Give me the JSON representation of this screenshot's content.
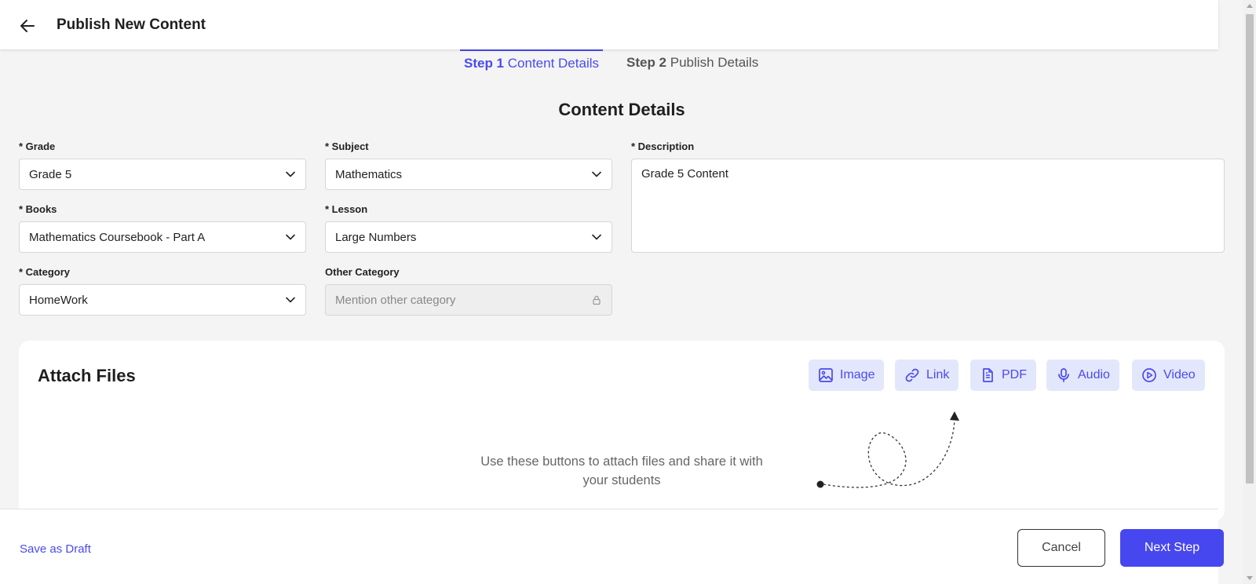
{
  "header": {
    "title": "Publish New Content"
  },
  "steps": [
    {
      "number": "Step 1",
      "label": "Content Details",
      "active": true
    },
    {
      "number": "Step 2",
      "label": "Publish Details",
      "active": false
    }
  ],
  "section_title": "Content Details",
  "fields": {
    "grade": {
      "label": "* Grade",
      "value": "Grade 5"
    },
    "subject": {
      "label": "* Subject",
      "value": "Mathematics"
    },
    "description": {
      "label": "* Description",
      "value": "Grade 5 Content"
    },
    "books": {
      "label": "* Books",
      "value": "Mathematics Coursebook - Part A"
    },
    "lesson": {
      "label": "* Lesson",
      "value": "Large Numbers"
    },
    "category": {
      "label": "* Category",
      "value": "HomeWork"
    },
    "other_category": {
      "label": "Other Category",
      "placeholder": "Mention other category"
    }
  },
  "attach": {
    "title": "Attach Files",
    "buttons": [
      {
        "label": "Image",
        "icon": "image-icon"
      },
      {
        "label": "Link",
        "icon": "link-icon"
      },
      {
        "label": "PDF",
        "icon": "file-text-icon"
      },
      {
        "label": "Audio",
        "icon": "microphone-icon"
      },
      {
        "label": "Video",
        "icon": "play-circle-icon"
      }
    ],
    "hint": "Use these buttons to attach files and share it with your students"
  },
  "footer": {
    "draft_label": "Save as Draft",
    "cancel_label": "Cancel",
    "next_label": "Next Step"
  },
  "colors": {
    "accent": "#4a4af0",
    "attach_button_bg": "#e3e7fb",
    "page_bg": "#f4f4f4"
  }
}
